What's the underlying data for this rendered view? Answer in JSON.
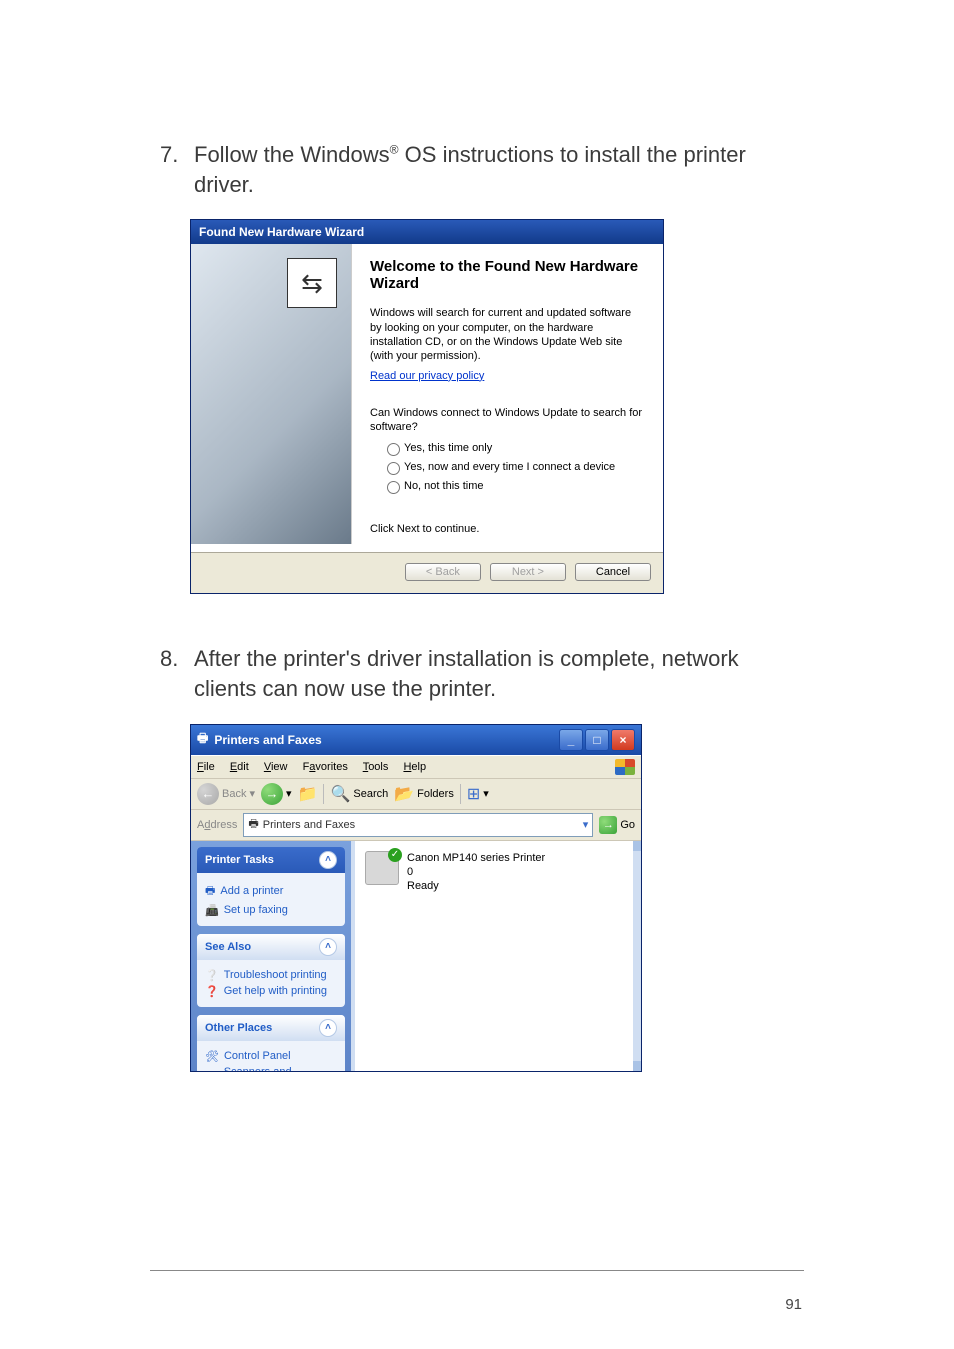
{
  "steps": {
    "s7": {
      "num": "7.",
      "text_a": "Follow the Windows",
      "reg": "®",
      "text_b": " OS instructions to install the printer driver."
    },
    "s8": {
      "num": "8.",
      "text": "After the printer's driver installation is complete, network clients can now use the printer."
    }
  },
  "wizard": {
    "title": "Found New Hardware Wizard",
    "heading": "Welcome to the Found New Hardware Wizard",
    "intro": "Windows will search for current and updated software by looking on your computer, on the hardware installation CD, or on the Windows Update Web site (with your permission).",
    "privacy": "Read our privacy policy",
    "question": "Can Windows connect to Windows Update to search for software?",
    "opt1": "Yes, this time only",
    "opt2": "Yes, now and every time I connect a device",
    "opt3": "No, not this time",
    "continue": "Click Next to continue.",
    "btn_back": "< Back",
    "btn_next": "Next >",
    "btn_cancel": "Cancel"
  },
  "explorer": {
    "title": "Printers and Faxes",
    "menu": {
      "file": "File",
      "edit": "Edit",
      "view": "View",
      "favorites": "Favorites",
      "tools": "Tools",
      "help": "Help"
    },
    "toolbar": {
      "back": "Back",
      "search": "Search",
      "folders": "Folders"
    },
    "address": {
      "label": "Address",
      "value": "Printers and Faxes",
      "go": "Go"
    },
    "panels": {
      "printer_tasks": {
        "title": "Printer Tasks",
        "add": "Add a printer",
        "fax": "Set up faxing"
      },
      "see_also": {
        "title": "See Also",
        "troubleshoot": "Troubleshoot printing",
        "help": "Get help with printing"
      },
      "other_places": {
        "title": "Other Places",
        "cp": "Control Panel",
        "scan": "Scanners and Cameras"
      }
    },
    "printer": {
      "name": "Canon MP140 series Printer",
      "docs": "0",
      "status": "Ready"
    }
  },
  "pagenum": "91"
}
